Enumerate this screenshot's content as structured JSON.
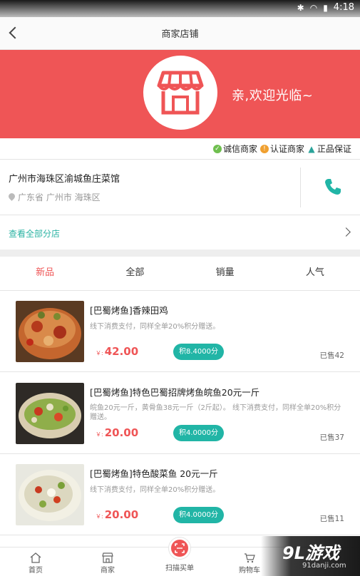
{
  "status_bar": {
    "time": "4:18"
  },
  "header": {
    "title": "商家店铺"
  },
  "banner": {
    "welcome": "亲,欢迎光临~",
    "bg_color": "#ef5556"
  },
  "badges": [
    {
      "label": "诚信商家",
      "icon": "check-circle-icon"
    },
    {
      "label": "认证商家",
      "icon": "certified-icon"
    },
    {
      "label": "正品保证",
      "icon": "thumbs-up-icon"
    }
  ],
  "store": {
    "name": "广州市海珠区渝城鱼庄菜馆",
    "location": "广东省 广州市 海珠区"
  },
  "view_all": {
    "label": "查看全部分店"
  },
  "tabs": [
    {
      "label": "新品",
      "active": true
    },
    {
      "label": "全部",
      "active": false
    },
    {
      "label": "销量",
      "active": false
    },
    {
      "label": "人气",
      "active": false
    }
  ],
  "products": [
    {
      "title": "[巴蜀烤鱼]香辣田鸡",
      "desc": "线下消费支付，同样全单20%积分赠送。",
      "currency": "￥:",
      "price": "42.00",
      "points": "积8.4000分",
      "sold": "已售42"
    },
    {
      "title": "[巴蜀烤鱼]特色巴蜀招牌烤鱼皖鱼20元一斤",
      "desc": "皖鱼20元一斤，黄骨鱼38元一斤（2斤起）。 线下消费支付，同样全单20%积分赠送。",
      "currency": "￥:",
      "price": "20.00",
      "points": "积4.0000分",
      "sold": "已售37"
    },
    {
      "title": "[巴蜀烤鱼]特色酸菜鱼 20元一斤",
      "desc": "线下消费支付，同样全单20%积分赠送。",
      "currency": "￥:",
      "price": "20.00",
      "points": "积4.0000分",
      "sold": "已售11"
    }
  ],
  "bottom_nav": {
    "home": "首页",
    "merchant": "商家",
    "scan": "扫描买单",
    "cart": "购物车"
  },
  "watermark": {
    "logo": "9L游戏",
    "url": "91danji.com"
  },
  "colors": {
    "accent": "#ef5556",
    "teal": "#21b5a6"
  }
}
